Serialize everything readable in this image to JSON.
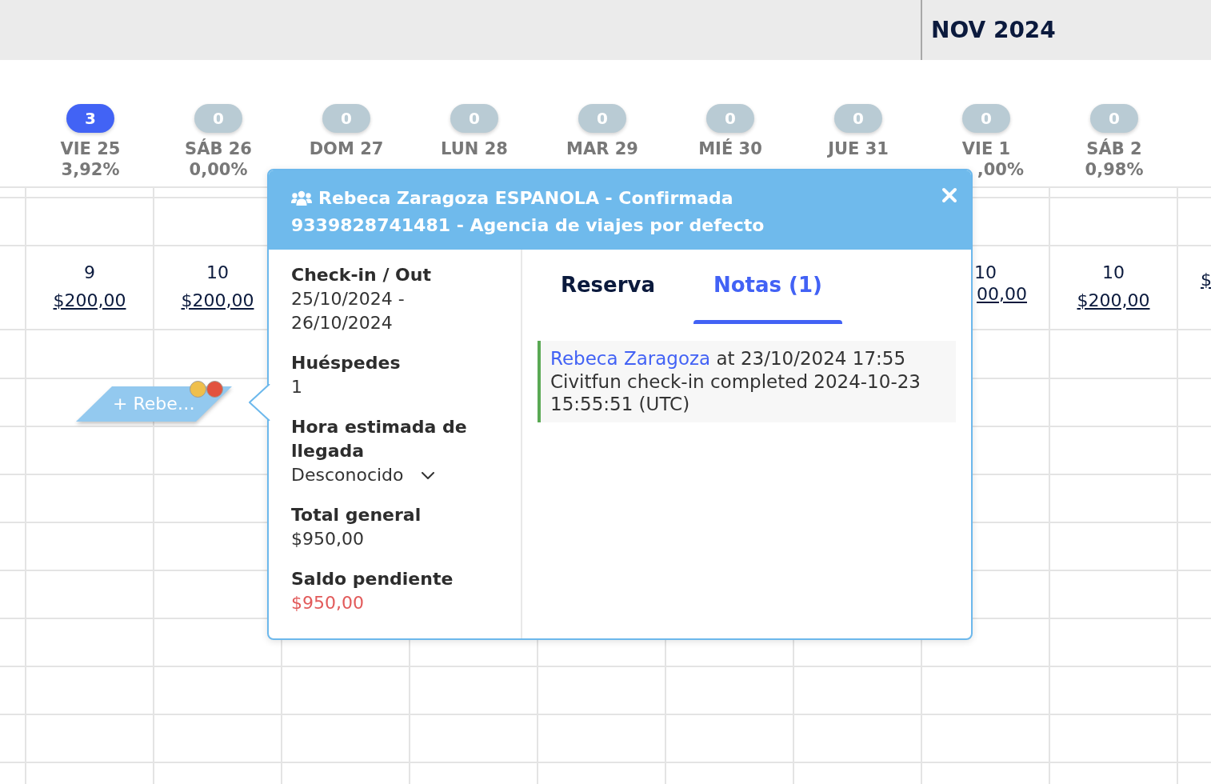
{
  "month_bar": {
    "label": "NOV 2024"
  },
  "days": [
    {
      "kind": "full",
      "badge": {
        "count": "3",
        "color": "#4263f5"
      },
      "name": "VIE 25",
      "occupancy": "3,92%",
      "count": "9",
      "price": "$200,00",
      "starts_month": false
    },
    {
      "kind": "full",
      "badge": {
        "count": "0",
        "color": "#b9cbd4"
      },
      "name": "SÁB 26",
      "occupancy": "0,00%",
      "count": "10",
      "price": "$200,00",
      "starts_month": false
    },
    {
      "kind": "full",
      "badge": {
        "count": "0",
        "color": "#b9cbd4"
      },
      "name": "DOM 27",
      "starts_month": false
    },
    {
      "kind": "full",
      "badge": {
        "count": "0",
        "color": "#b9cbd4"
      },
      "name": "LUN 28",
      "starts_month": false
    },
    {
      "kind": "full",
      "badge": {
        "count": "0",
        "color": "#b9cbd4"
      },
      "name": "MAR 29",
      "starts_month": false
    },
    {
      "kind": "full",
      "badge": {
        "count": "0",
        "color": "#b9cbd4"
      },
      "name": "MIÉ 30",
      "starts_month": false
    },
    {
      "kind": "full",
      "badge": {
        "count": "0",
        "color": "#b9cbd4"
      },
      "name": "JUE 31",
      "starts_month": false
    },
    {
      "kind": "partly_covered",
      "badge": {
        "count": "0",
        "color": "#b9cbd4"
      },
      "name": "VIE 1",
      "occupancy": ",00%",
      "count": "10",
      "price": "00,00",
      "starts_month": true
    },
    {
      "kind": "full",
      "badge": {
        "count": "0",
        "color": "#b9cbd4"
      },
      "name": "SÁB 2",
      "occupancy": "0,98%",
      "count": "10",
      "price": "$200,00",
      "starts_month": false
    },
    {
      "kind": "cut_off",
      "price": "$",
      "starts_month": false
    }
  ],
  "booking": {
    "label": "+ Rebe…",
    "flags": [
      {
        "color": "#efbf4c"
      },
      {
        "color": "#e2533f"
      }
    ]
  },
  "popover": {
    "title": "Rebeca Zaragoza ESPANOLA - Confirmada",
    "subtitle": "9339828741481 - Agencia de viajes por defecto",
    "details": [
      {
        "kind": "text",
        "label": "Check-in / Out",
        "value": "25/10/2024 - 26/10/2024"
      },
      {
        "kind": "text",
        "label": "Huéspedes",
        "value": "1"
      },
      {
        "kind": "select",
        "label": "Hora estimada de llegada",
        "value": "Desconocido"
      },
      {
        "kind": "text",
        "label": "Total general",
        "value": "$950,00"
      },
      {
        "kind": "alert",
        "label": "Saldo pendiente",
        "value": "$950,00"
      }
    ],
    "tabs": [
      {
        "label": "Reserva",
        "selected": false
      },
      {
        "label": "Notas (1)",
        "selected": true
      }
    ],
    "notes": [
      {
        "author": "Rebeca Zaragoza",
        "timestamp": "at 23/10/2024 17:55",
        "text": "Civitfun check-in completed 2024-10-23 15:55:51 (UTC)"
      }
    ]
  }
}
